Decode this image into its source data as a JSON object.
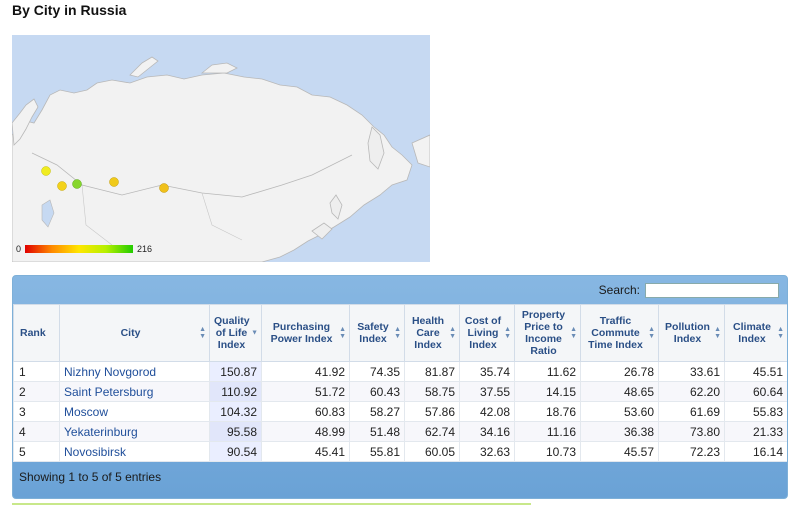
{
  "page": {
    "title": "By City in Russia"
  },
  "map": {
    "legend_min": "0",
    "legend_max": "216",
    "colors": {
      "water": "#c6d9f2",
      "land": "#f2f2f2",
      "border": "#b8b8b8"
    },
    "markers": [
      {
        "city": "Nizhny Novgorod",
        "value": 150.87,
        "color": "#f3d21a"
      },
      {
        "city": "Saint Petersburg",
        "value": 110.92,
        "color": "#f0ec20"
      },
      {
        "city": "Moscow",
        "value": 104.32,
        "color": "#86d62c"
      },
      {
        "city": "Yekaterinburg",
        "value": 95.58,
        "color": "#f0ca1a"
      },
      {
        "city": "Novosibirsk",
        "value": 90.54,
        "color": "#f0c01a"
      }
    ]
  },
  "table": {
    "search_label": "Search:",
    "search_value": "",
    "columns": [
      "Rank",
      "City",
      "Quality of Life Index",
      "Purchasing Power Index",
      "Safety Index",
      "Health Care Index",
      "Cost of Living Index",
      "Property Price to Income Ratio",
      "Traffic Commute Time Index",
      "Pollution Index",
      "Climate Index"
    ],
    "rows": [
      [
        "1",
        "Nizhny Novgorod",
        "150.87",
        "41.92",
        "74.35",
        "81.87",
        "35.74",
        "11.62",
        "26.78",
        "33.61",
        "45.51"
      ],
      [
        "2",
        "Saint Petersburg",
        "110.92",
        "51.72",
        "60.43",
        "58.75",
        "37.55",
        "14.15",
        "48.65",
        "62.20",
        "60.64"
      ],
      [
        "3",
        "Moscow",
        "104.32",
        "60.83",
        "58.27",
        "57.86",
        "42.08",
        "18.76",
        "53.60",
        "61.69",
        "55.83"
      ],
      [
        "4",
        "Yekaterinburg",
        "95.58",
        "48.99",
        "51.48",
        "62.74",
        "34.16",
        "11.16",
        "36.38",
        "73.80",
        "21.33"
      ],
      [
        "5",
        "Novosibirsk",
        "90.54",
        "45.41",
        "55.81",
        "60.05",
        "32.63",
        "10.73",
        "45.57",
        "72.23",
        "16.14"
      ]
    ],
    "footer": "Showing 1 to 5 of 5 entries"
  }
}
